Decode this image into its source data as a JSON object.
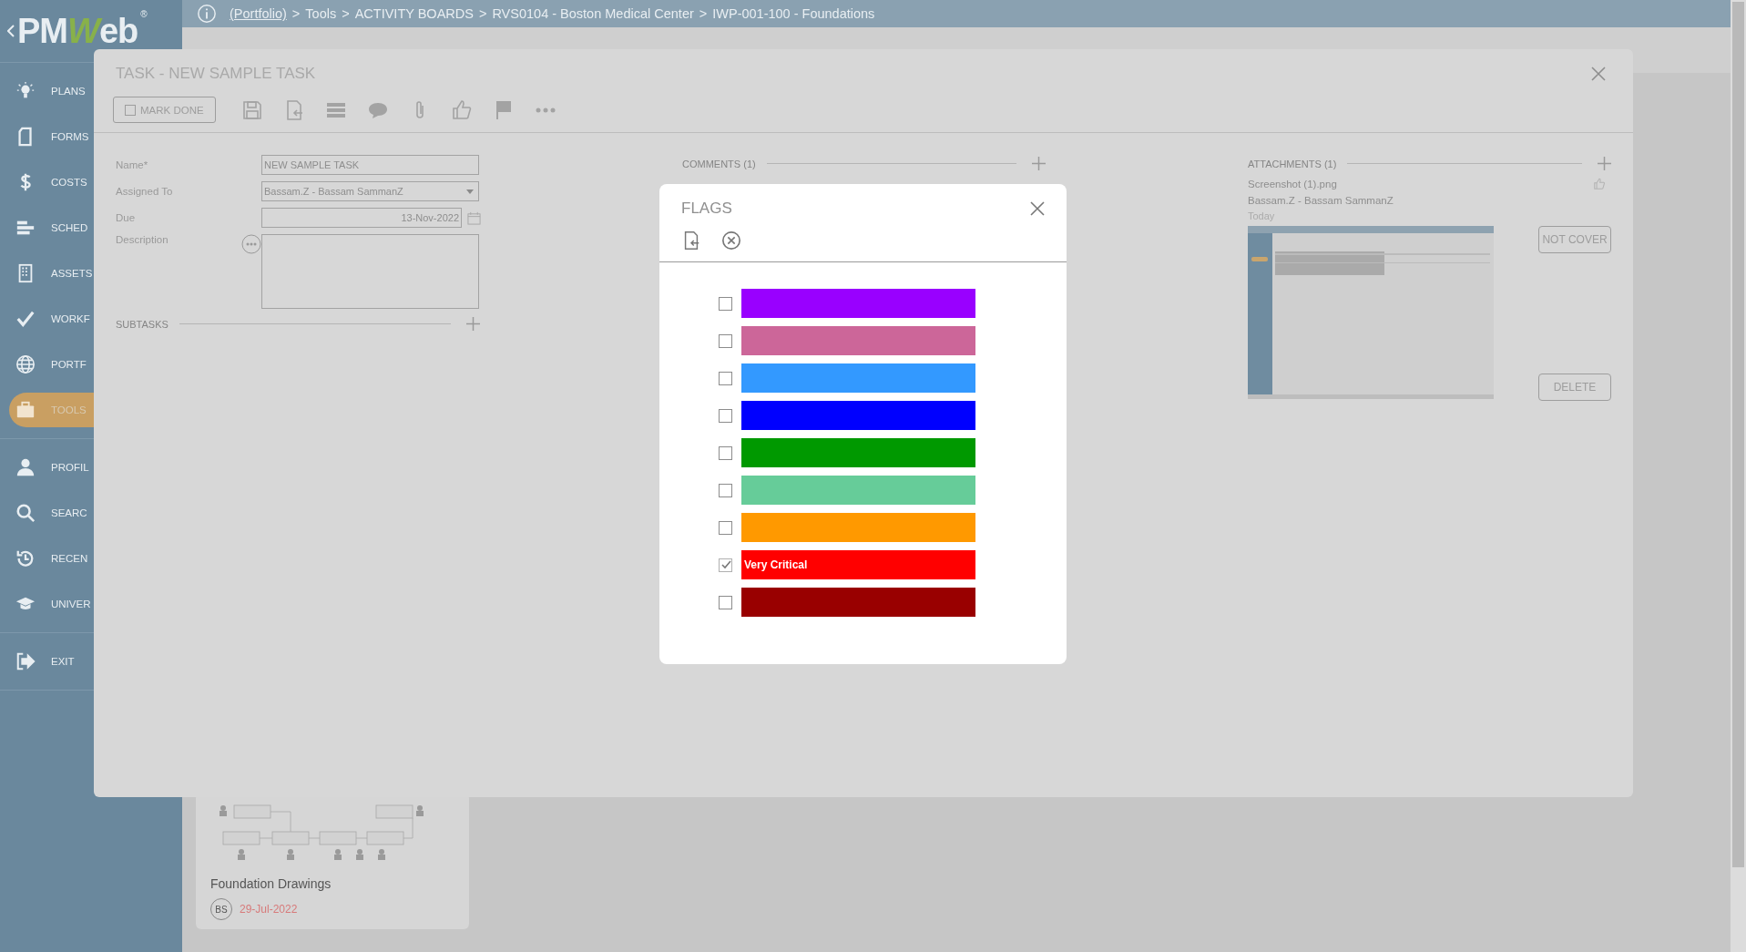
{
  "header": {
    "logo": "PMWeb",
    "registered": "®",
    "separator": ">",
    "breadcrumb": [
      {
        "text": "(Portfolio)",
        "kind": "link"
      },
      {
        "text": "Tools",
        "kind": "text"
      },
      {
        "text": "ACTIVITY BOARDS",
        "kind": "text"
      },
      {
        "text": "RVS0104 - Boston Medical Center",
        "kind": "text"
      },
      {
        "text": "IWP-001-100 - Foundations",
        "kind": "text"
      }
    ]
  },
  "sidebar": {
    "sections": [
      {
        "items": [
          {
            "label": "PLANS",
            "selected": false
          },
          {
            "label": "FORMS",
            "selected": false
          },
          {
            "label": "COSTS",
            "selected": false
          },
          {
            "label": "SCHED",
            "selected": false
          },
          {
            "label": "ASSETS",
            "selected": false
          },
          {
            "label": "WORKF",
            "selected": false
          },
          {
            "label": "PORTF",
            "selected": false
          },
          {
            "label": "TOOLS",
            "selected": true
          }
        ]
      },
      {
        "items": [
          {
            "label": "PROFIL",
            "selected": false
          },
          {
            "label": "SEARC",
            "selected": false
          },
          {
            "label": "RECEN",
            "selected": false
          },
          {
            "label": "UNIVER",
            "selected": false
          }
        ]
      },
      {
        "items": [
          {
            "label": "EXIT",
            "selected": false
          }
        ]
      }
    ]
  },
  "board_card": {
    "title": "Foundation Drawings",
    "initials": "BS",
    "date": "29-Jul-2022"
  },
  "task_dialog": {
    "title": "TASK - NEW SAMPLE TASK",
    "mark_done": {
      "label": "MARK DONE",
      "checked": false
    },
    "fields": [
      {
        "label": "Name*",
        "value": "NEW SAMPLE TASK",
        "kind": "text"
      },
      {
        "label": "Assigned To",
        "value": "Bassam.Z - Bassam SammanZ",
        "kind": "select"
      },
      {
        "label": "Due",
        "value": "13-Nov-2022",
        "kind": "date"
      },
      {
        "label": "Description",
        "kind": "textarea"
      }
    ],
    "subtasks": {
      "title": "SUBTASKS"
    },
    "comments": {
      "title": "COMMENTS (1)"
    },
    "attachments": {
      "title": "ATTACHMENTS (1)",
      "items": [
        {
          "file": "Screenshot (1).png",
          "user": "Bassam.Z - Bassam SammanZ",
          "date": "Today",
          "cover_button": "NOT COVER",
          "delete_button": "DELETE"
        }
      ]
    }
  },
  "flags_dialog": {
    "title": "FLAGS",
    "flags": [
      {
        "color": "#9900ff",
        "checked": false
      },
      {
        "color": "#cc6699",
        "checked": false
      },
      {
        "color": "#3399ff",
        "checked": false
      },
      {
        "color": "#0000ff",
        "checked": false
      },
      {
        "color": "#009900",
        "checked": false
      },
      {
        "color": "#66cc99",
        "checked": false
      },
      {
        "color": "#ff9900",
        "checked": false
      },
      {
        "color": "#ff0000",
        "checked": true,
        "label": "Very Critical"
      },
      {
        "color": "#990000",
        "checked": false
      }
    ]
  }
}
